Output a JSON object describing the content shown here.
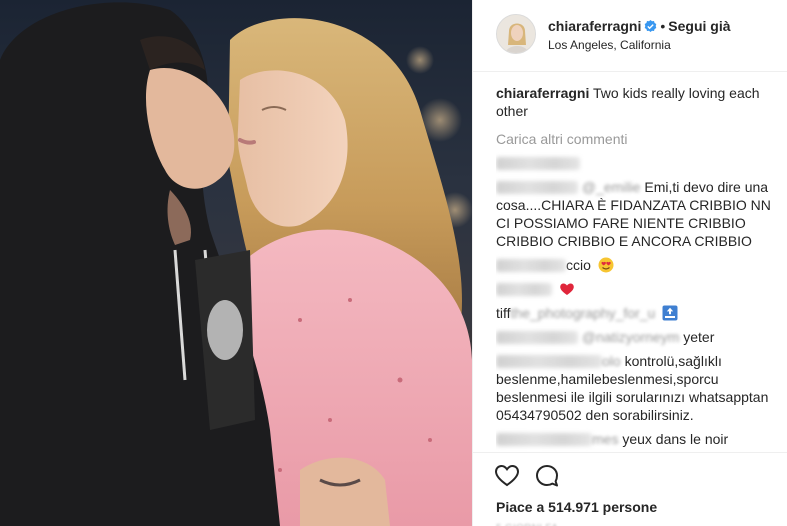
{
  "post": {
    "photo_alt": "",
    "username": "chiaraferragni",
    "verified_icon": "verified-badge-icon",
    "separator": "•",
    "follow_label": "Segui già",
    "location": "Los Angeles, California"
  },
  "caption": {
    "username": "chiaraferragni",
    "text": "Two kids really loving each other"
  },
  "load_more_label": "Carica altri commenti",
  "comments": [
    {
      "author": "",
      "text": ""
    },
    {
      "author": "",
      "mention": "@_emilie",
      "text": "Emi,ti devo dire una cosa....CHIARA È FIDANZATA CRIBBIO NN CI POSSIAMO FARE NIENTE CRIBBIO CRIBBIO CRIBBIO E ANCORA CRIBBIO"
    },
    {
      "author": "",
      "text_tail": "ccio",
      "emoji": "heart-eyes-emoji"
    },
    {
      "author": "",
      "emoji": "red-heart-emoji"
    },
    {
      "author_visible": "tiff",
      "author_blurred": "the_photography_for_u",
      "emoji": "top-arrow-emoji"
    },
    {
      "author": "",
      "mention": "@natizyorneym",
      "text": "yeter"
    },
    {
      "author": "",
      "text_head": "olo",
      "text": "kontrolü,sağlıklı beslenme,hamilebeslenmesi,sporcu beslenmesi ile ilgili sorularınızı whatsapptan 05434790502 den sorabilirsiniz."
    },
    {
      "author": "",
      "text_head": "mes",
      "text": "yeux dans le noir"
    }
  ],
  "actions": {
    "like_icon": "heart-outline-icon",
    "comment_icon": "comment-bubble-icon",
    "likes_text": "Piace a 514.971 persone"
  },
  "colors": {
    "text": "#262626",
    "muted": "#999999",
    "verified": "#3897f0",
    "border": "#efefef"
  }
}
